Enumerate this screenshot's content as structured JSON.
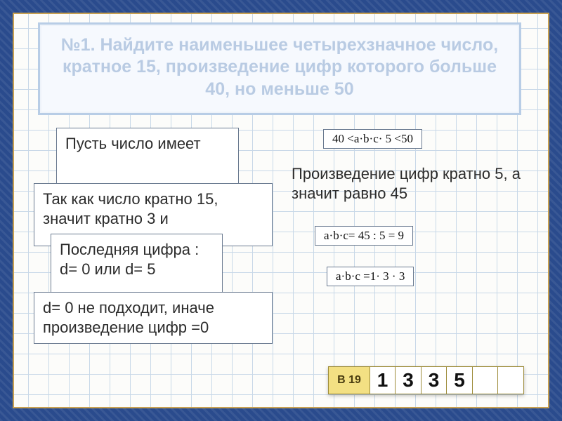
{
  "title": "№1. Найдите наименьшее четырехзначное число, кратное 15, произведение цифр которого больше 40, но меньше 50",
  "cards": {
    "c1": "Пусть число имеет",
    "c2a": "Так как  число кратно 15,",
    "c2b": "значит кратно 3 и",
    "c3a": "Последняя цифра :",
    "c3b": "d= 0 или d= 5",
    "c4": "d= 0  не подходит, иначе произведение цифр =0"
  },
  "right": {
    "r1": "Произведение цифр кратно 5, а значит равно 45"
  },
  "formulas": {
    "f1": "40 <a·b·c· 5 <50",
    "f2": "a·b·c= 45 : 5 = 9",
    "f3": "a·b·c =1· 3 · 3"
  },
  "answer": {
    "label": "В 19",
    "cells": [
      "1",
      "3",
      "3",
      "5",
      "",
      ""
    ]
  }
}
